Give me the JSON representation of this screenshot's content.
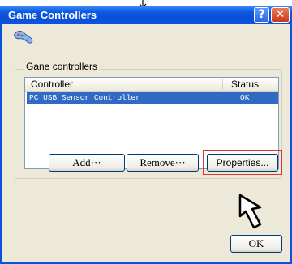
{
  "window": {
    "title": "Game Controllers",
    "help_glyph": "?",
    "close_glyph": "✕",
    "app_icon": "gamepad-icon"
  },
  "group": {
    "legend": "Gane controllers"
  },
  "list": {
    "columns": [
      "Controller",
      "Status"
    ],
    "rows": [
      {
        "controller": "PC USB Sensor Controller",
        "status": "OK",
        "selected": true
      }
    ]
  },
  "buttons": {
    "add": "Add···",
    "remove": "Remove···",
    "properties": "Properties...",
    "ok": "OK"
  },
  "annotations": {
    "highlight_color": "#dd3333",
    "cursor": "arrow-cursor-icon",
    "top_marker": "down-arrow-icon"
  },
  "colors": {
    "titlebar": "#0a54dc",
    "selection": "#316ac5",
    "dialog_bg": "#ece9d8"
  }
}
